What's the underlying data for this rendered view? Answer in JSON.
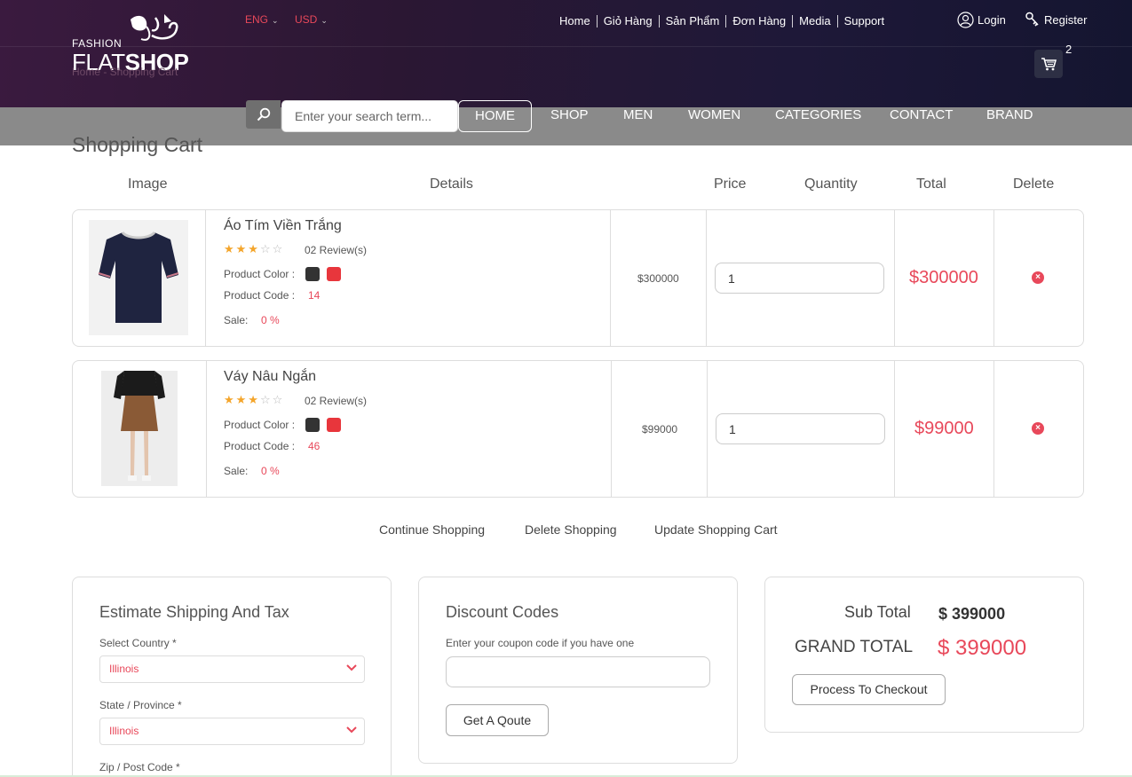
{
  "header": {
    "logo_small": "FASHION",
    "logo_flat": "FLAT",
    "logo_shop": "SHOP",
    "breadcrumb": "Home - Shopping Cart",
    "language": "ENG",
    "currency": "USD",
    "top_nav": [
      "Home",
      "Giỏ Hàng",
      "Sản Phẩm",
      "Đơn Hàng",
      "Media",
      "Support"
    ],
    "login_label": "Login",
    "register_label": "Register",
    "cart_count": "2"
  },
  "search": {
    "placeholder": "Enter your search term..."
  },
  "main_nav": [
    "HOME",
    "SHOP",
    "MEN",
    "WOMEN",
    "CATEGORIES",
    "CONTACT",
    "BRAND"
  ],
  "page_title": "Shopping Cart",
  "table_headers": {
    "image": "Image",
    "details": "Details",
    "price": "Price",
    "quantity": "Quantity",
    "total": "Total",
    "delete": "Delete"
  },
  "labels": {
    "product_color": "Product Color :",
    "product_code": "Product Code :",
    "sale": "Sale:",
    "reviews": "02 Review(s)"
  },
  "items": [
    {
      "name": "Áo Tím Viền Trắng",
      "rating": 3,
      "code": "14",
      "sale": "0 %",
      "price": "$300000",
      "quantity": "1",
      "total": "$300000",
      "colors": [
        "#333333",
        "#e8363c"
      ]
    },
    {
      "name": "Váy Nâu Ngắn",
      "rating": 3,
      "code": "46",
      "sale": "0 %",
      "price": "$99000",
      "quantity": "1",
      "total": "$99000",
      "colors": [
        "#333333",
        "#e8363c"
      ]
    }
  ],
  "cart_actions": {
    "continue": "Continue Shopping",
    "delete": "Delete Shopping",
    "update": "Update Shopping Cart"
  },
  "shipping": {
    "title": "Estimate Shipping And Tax",
    "country_label": "Select Country *",
    "country_value": "Illinois",
    "state_label": "State / Province *",
    "state_value": "Illinois",
    "zip_label": "Zip / Post Code *"
  },
  "discount": {
    "title": "Discount Codes",
    "hint": "Enter your coupon code if you have one",
    "button": "Get A Qoute"
  },
  "summary": {
    "subtotal_label": "Sub Total",
    "subtotal_value": "$ 399000",
    "grand_label": "GRAND TOTAL",
    "grand_value": "$ 399000",
    "checkout_button": "Process To Checkout"
  },
  "colors": {
    "accent": "#e8485a",
    "menubar": "#8a8a8a",
    "star": "#f4a52b"
  }
}
